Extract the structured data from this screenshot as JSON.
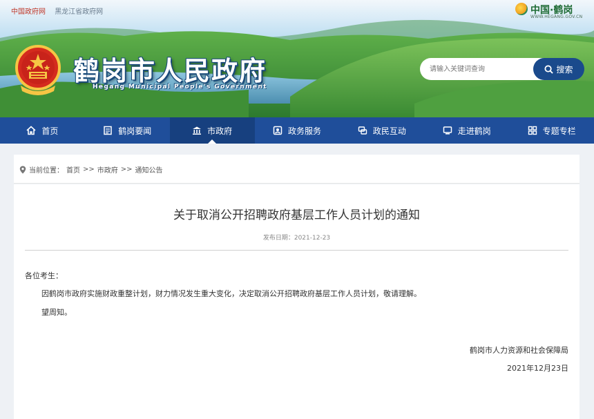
{
  "topbar": {
    "links": [
      "中国政府网",
      "黑龙江省政府网"
    ],
    "logo_text": "中国·鹤岗",
    "logo_domain": "WWW.HEGANG.GOV.CN"
  },
  "header": {
    "site_title": "鹤岗市人民政府",
    "site_subtitle": "Hegang Municipal People's Government"
  },
  "search": {
    "placeholder": "请输入关键词查询",
    "button_label": "搜索"
  },
  "nav": {
    "items": [
      {
        "label": "首页",
        "icon": "home-icon"
      },
      {
        "label": "鹤岗要闻",
        "icon": "news-icon"
      },
      {
        "label": "市政府",
        "icon": "government-building-icon"
      },
      {
        "label": "政务服务",
        "icon": "service-icon"
      },
      {
        "label": "政民互动",
        "icon": "chat-icon"
      },
      {
        "label": "走进鹤岗",
        "icon": "monitor-icon"
      },
      {
        "label": "专题专栏",
        "icon": "grid-icon"
      }
    ],
    "active_index": 2
  },
  "breadcrumb": {
    "prefix": "当前位置：",
    "items": [
      "首页",
      "市政府",
      "通知公告"
    ],
    "separator": ">>"
  },
  "article": {
    "title": "关于取消公开招聘政府基层工作人员计划的通知",
    "date_label": "发布日期：2021-12-23",
    "greeting": "各位考生：",
    "body": "因鹤岗市政府实施财政重整计划，财力情况发生重大变化，决定取消公开招聘政府基层工作人员计划，敬请理解。",
    "closing": "望周知。",
    "signature": "鹤岗市人力资源和社会保障局",
    "sign_date": "2021年12月23日"
  },
  "colors": {
    "nav_bg": "#1f4e9a",
    "nav_active": "#17407f",
    "search_button": "#1a4a8c",
    "top_link": "#c0392b"
  }
}
